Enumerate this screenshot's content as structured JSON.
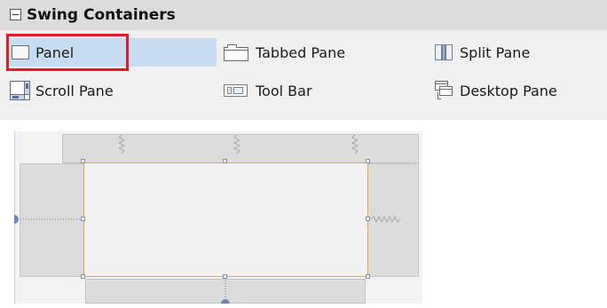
{
  "palette": {
    "title": "Swing Containers",
    "items": [
      {
        "label": "Panel",
        "icon": "panel-icon",
        "selected": true
      },
      {
        "label": "Tabbed Pane",
        "icon": "tabbed-pane-icon"
      },
      {
        "label": "Split Pane",
        "icon": "split-pane-icon"
      },
      {
        "label": "Scroll Pane",
        "icon": "scroll-pane-icon"
      },
      {
        "label": "Tool Bar",
        "icon": "tool-bar-icon"
      },
      {
        "label": "Desktop Pane",
        "icon": "desktop-pane-icon"
      }
    ]
  },
  "colors": {
    "header_bg": "#dcdcdc",
    "selected_bg": "#c7dcf0",
    "highlight_border": "#e8181e",
    "component_border": "#f0a81c"
  }
}
